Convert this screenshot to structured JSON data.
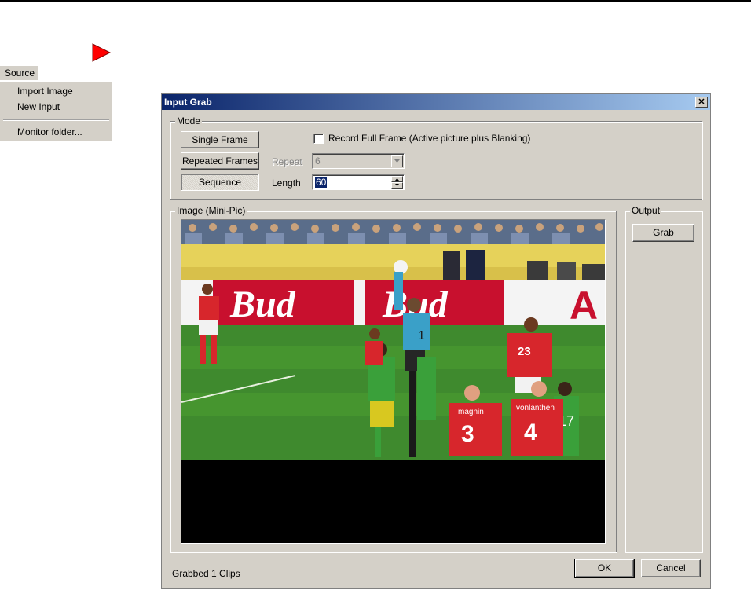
{
  "context_menu": {
    "header": "Source",
    "items": [
      {
        "label": "Import Image"
      },
      {
        "label": "New Input"
      },
      {
        "label": "Monitor folder..."
      }
    ]
  },
  "dialog": {
    "title": "Input Grab",
    "close_glyph": "✕",
    "mode": {
      "legend": "Mode",
      "single_frame": "Single Frame",
      "repeated_frames": "Repeated Frames",
      "sequence": "Sequence",
      "record_full_frame": "Record Full Frame (Active picture plus Blanking)",
      "record_full_frame_checked": false,
      "repeat_label": "Repeat",
      "repeat_value": "6",
      "length_label": "Length",
      "length_value": "60"
    },
    "image": {
      "legend": "Image (Mini-Pic)",
      "banner_text_1": "Bud",
      "banner_text_2": "Bud",
      "banner_text_3": "A",
      "shirt_23": "23",
      "shirt_3": "3",
      "shirt_4": "4",
      "shirt_17": "17",
      "shirt_1": "1",
      "name_magnin": "magnin",
      "name_vonlanthen": "vonlanthen"
    },
    "output": {
      "legend": "Output",
      "grab": "Grab"
    },
    "status_text": "Grabbed 1 Clips",
    "ok": "OK",
    "cancel": "Cancel"
  },
  "colors": {
    "title_start": "#0a246a",
    "title_end": "#a6caf0",
    "dialog_bg": "#d4d0c8",
    "play_red": "#ff0000"
  }
}
